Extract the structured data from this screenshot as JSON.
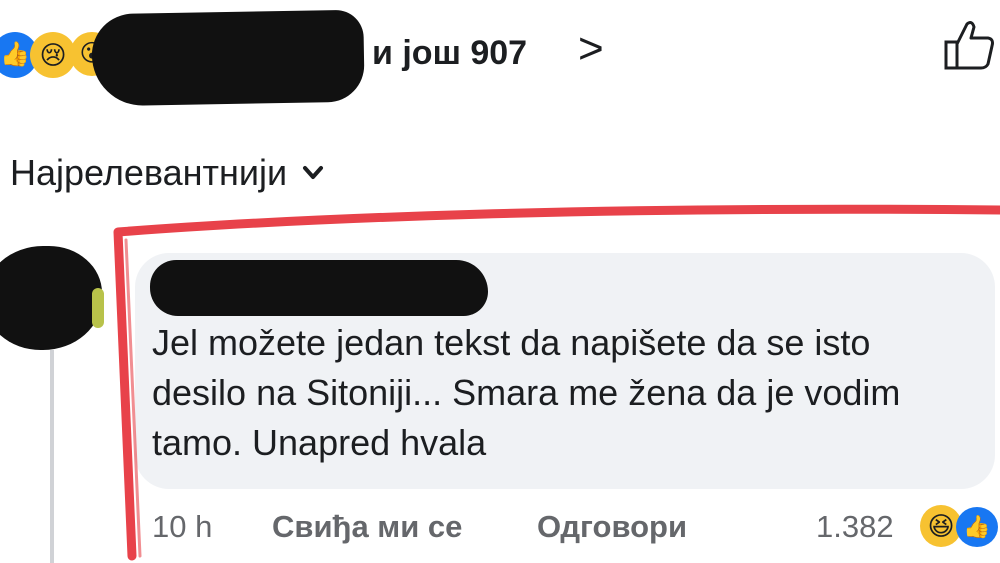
{
  "reactions": {
    "count_text": "и још 907",
    "icons": [
      "like-icon",
      "sad-icon",
      "wow-icon"
    ]
  },
  "sort": {
    "label": "Најрелевантнији"
  },
  "comment": {
    "text": "Jel možete jedan tekst da napišete da se isto desilo na Sitoniji... Smara me žena da je vodim tamo. Unapred hvala",
    "time": "10 h",
    "like_label": "Свиђа ми се",
    "reply_label": "Одговори",
    "reaction_count": "1.382",
    "reaction_icons": [
      "haha-icon",
      "like-icon"
    ]
  },
  "colors": {
    "annotation_red": "#e8424a",
    "bubble_bg": "#f0f2f5",
    "meta_text": "#65676b",
    "brand_blue": "#1877f2"
  }
}
